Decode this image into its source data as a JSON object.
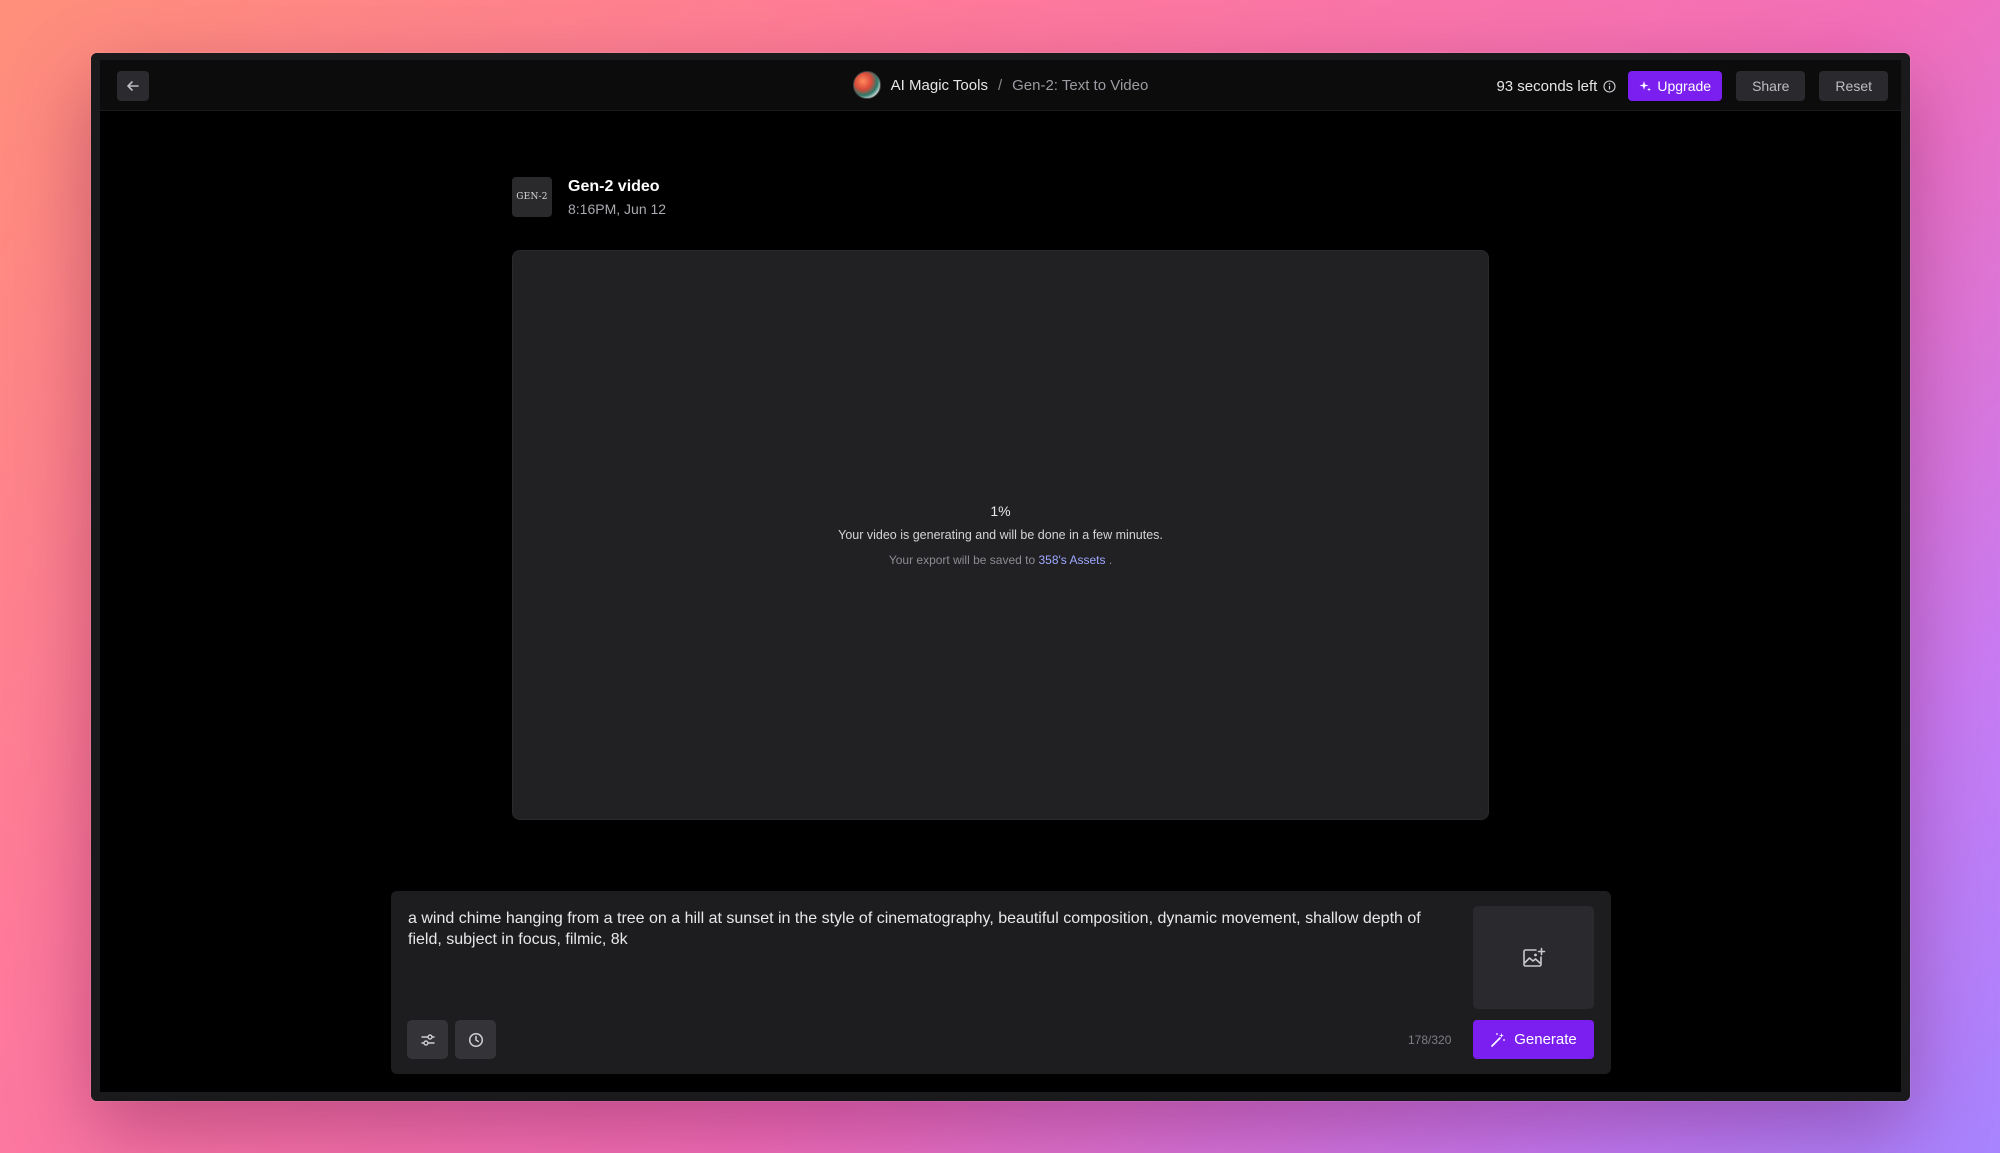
{
  "header": {
    "back_label": "Back",
    "app_name": "AI Magic Tools",
    "separator": "/",
    "current_page": "Gen-2: Text to Video",
    "time_left": "93 seconds left",
    "upgrade_label": "Upgrade",
    "share_label": "Share",
    "reset_label": "Reset"
  },
  "generation": {
    "logo_text": "GEN-2",
    "title": "Gen-2 video",
    "timestamp": "8:16PM, Jun 12",
    "progress_text": "1%",
    "progress_value": 1,
    "status_message": "Your video is generating and will be done in a few minutes.",
    "export_prefix": "Your export will be saved to",
    "export_link": "358's Assets",
    "export_suffix": "."
  },
  "composer": {
    "prompt": "a wind chime hanging from a tree on a hill at sunset in the style of cinematography, beautiful composition, dynamic movement, shallow depth of field, subject in focus, filmic, 8k",
    "char_count": "178/320",
    "generate_label": "Generate"
  },
  "icons": {
    "back": "arrow-left-icon",
    "info": "info-icon",
    "sparkle": "sparkle-icon",
    "image_upload": "image-add-icon",
    "settings": "sliders-icon",
    "history": "clock-icon",
    "magic_wand": "magic-wand-icon"
  },
  "colors": {
    "accent": "#7b1ff0",
    "link": "#9ea8ff",
    "panel": "#212123",
    "background": "#000000"
  }
}
